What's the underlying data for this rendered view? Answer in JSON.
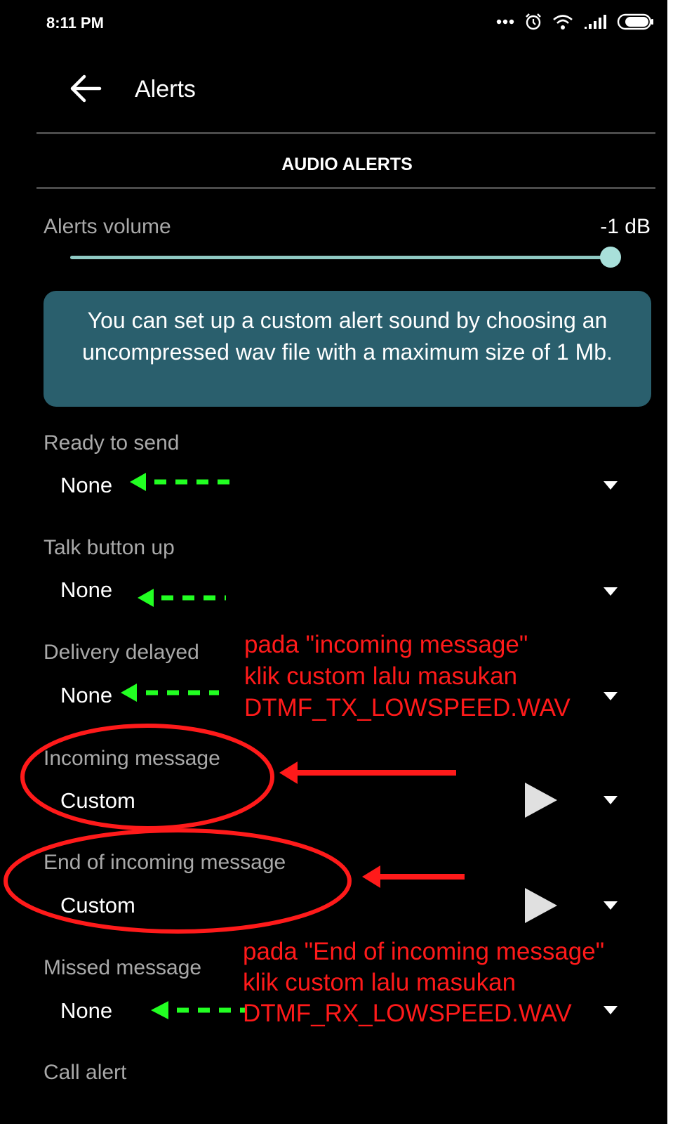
{
  "status_bar": {
    "time": "8:11 PM",
    "icons": [
      "more-icon",
      "alarm-icon",
      "wifi-icon",
      "signal-icon",
      "battery-icon"
    ]
  },
  "header": {
    "title": "Alerts"
  },
  "section": {
    "title": "AUDIO ALERTS"
  },
  "volume": {
    "label": "Alerts volume",
    "value": "-1 dB",
    "level_fraction": 0.99
  },
  "info": {
    "text": "You can set up a custom alert sound by choosing an uncompressed wav file with a maximum size of 1 Mb."
  },
  "alerts": [
    {
      "label": "Ready to send",
      "value": "None"
    },
    {
      "label": "Talk button up",
      "value": "None"
    },
    {
      "label": "Delivery delayed",
      "value": "None"
    },
    {
      "label": "Incoming message",
      "value": "Custom"
    },
    {
      "label": "End of incoming message",
      "value": "Custom"
    },
    {
      "label": "Missed message",
      "value": "None"
    },
    {
      "label": "Call alert",
      "value": ""
    }
  ],
  "annotations": {
    "note1": [
      "pada \"incoming message\"",
      "klik custom lalu masukan",
      "DTMF_TX_LOWSPEED.WAV"
    ],
    "note2": [
      "pada \"End of incoming message\"",
      "klik custom lalu masukan",
      "DTMF_RX_LOWSPEED.WAV"
    ]
  },
  "colors": {
    "background": "#000000",
    "info_box": "#2a5f6d",
    "slider": "#8fc9c3",
    "annotation_red": "#ff1a1a",
    "annotation_green": "#22ff22"
  }
}
